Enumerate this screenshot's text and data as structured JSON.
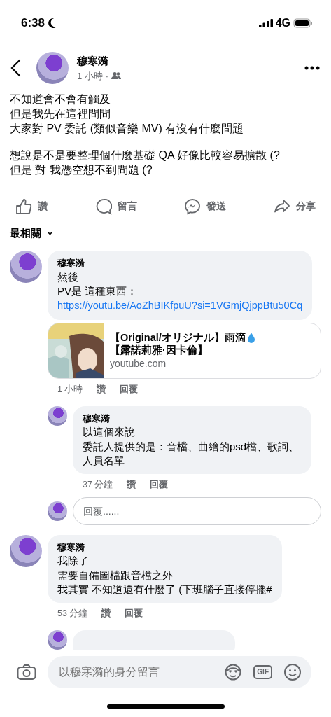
{
  "status_bar": {
    "time": "6:38",
    "network": "4G"
  },
  "post": {
    "author": "穆寒漪",
    "time": "1 小時",
    "separator": "·",
    "paragraphs": [
      [
        "不知道會不會有觸及",
        "但是我先在這裡問問",
        "大家對 PV 委託 (類似音樂 MV) 有沒有什麼問題"
      ],
      [
        "想說是不是要整理個什麼基礎 QA 好像比較容易擴散 (?",
        "但是 對 我憑空想不到問題 (?"
      ]
    ]
  },
  "actions": [
    {
      "kind": "like",
      "label": "讚"
    },
    {
      "kind": "comment",
      "label": "留言"
    },
    {
      "kind": "send",
      "label": "發送"
    },
    {
      "kind": "share",
      "label": "分享"
    }
  ],
  "sort": {
    "label": "最相關"
  },
  "comments": [
    {
      "author": "穆寒漪",
      "lines": [
        "然後",
        "PV是 這種東西："
      ],
      "link": "https://youtu.be/AoZhBIKfpuU?si=1VGmjQjppBtu50Cq",
      "preview": {
        "title": "【Original/オリジナル】雨滴",
        "title_end": "【露諾莉雅·因卡倫】",
        "domain": "youtube.com"
      },
      "time": "1 小時",
      "like": "讚",
      "reply": "回覆",
      "replies": [
        {
          "author": "穆寒漪",
          "lines": [
            "以這個來說",
            "委託人提供的是：音檔、曲繪的psd檔、歌詞、人員名單"
          ],
          "time": "37 分鐘",
          "like": "讚",
          "reply": "回覆"
        }
      ],
      "reply_box": {
        "placeholder": "回覆......"
      }
    },
    {
      "author": "穆寒漪",
      "lines": [
        "我除了",
        "需要自備圖檔跟音檔之外",
        "我其實 不知道還有什麼了 (下班腦子直接停擺#"
      ],
      "time": "53 分鐘",
      "like": "讚",
      "reply": "回覆",
      "partial_reply": true
    }
  ],
  "composer": {
    "placeholder": "以穆寒漪的身分留言",
    "gif_label": "GIF"
  }
}
